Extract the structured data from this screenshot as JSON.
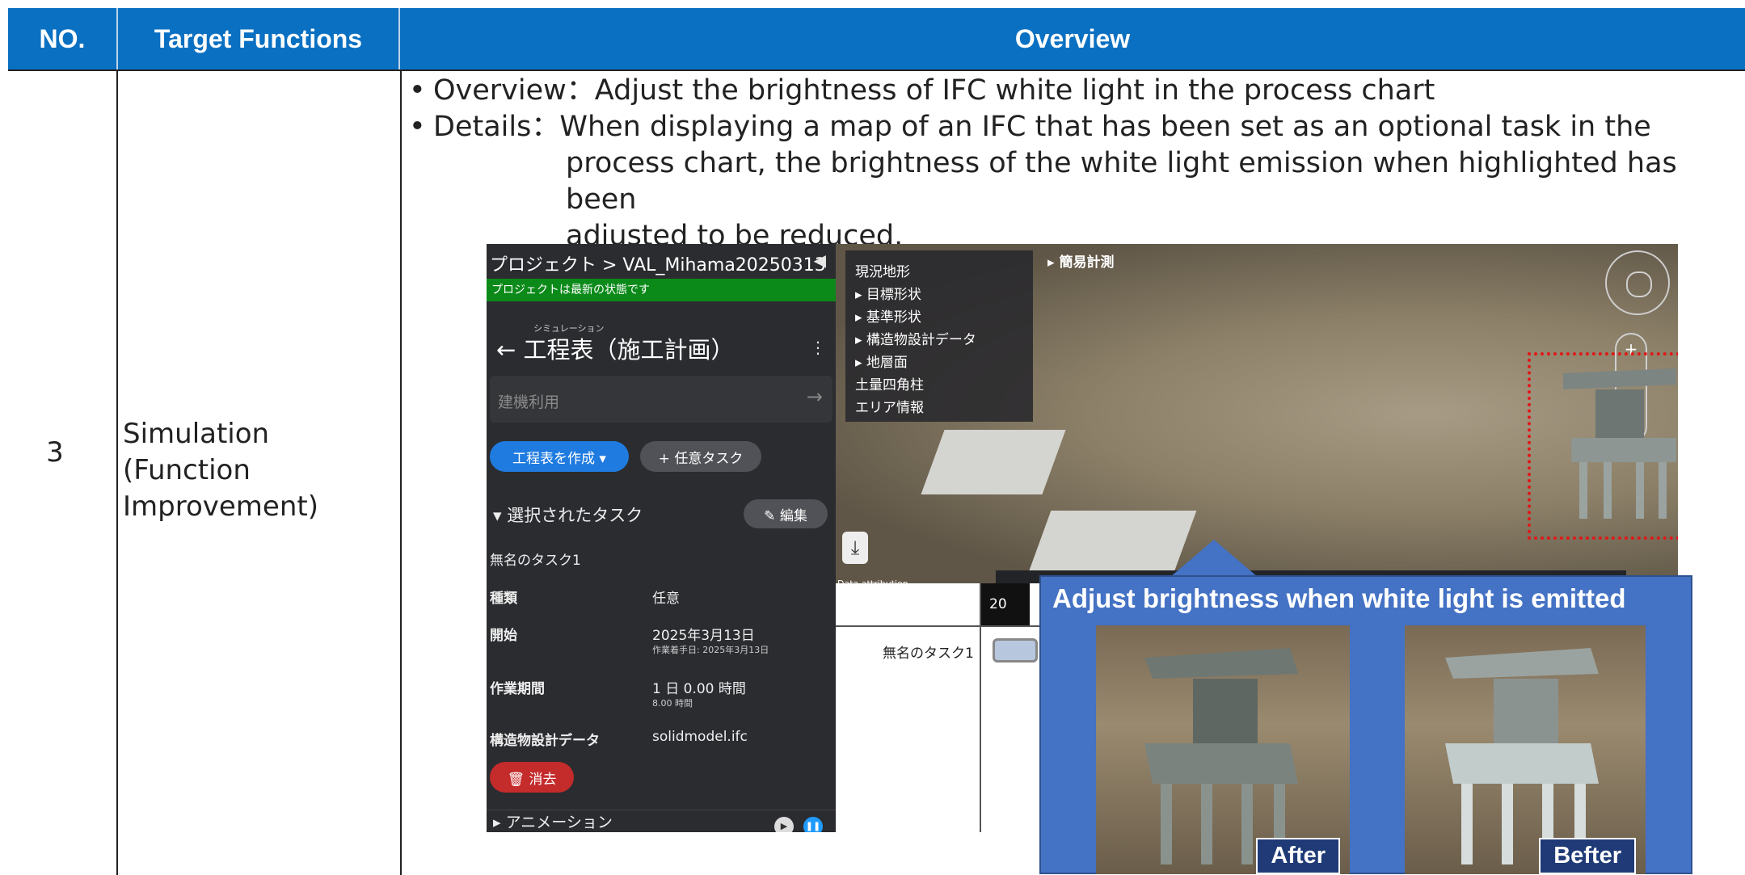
{
  "table": {
    "headers": [
      "NO.",
      "Target Functions",
      "Overview"
    ],
    "row": {
      "no": "3",
      "function": "Simulation\n(Function\nImprovement)",
      "overview_line": "Overview：Adjust the brightness of IFC white light in the process chart",
      "details_line1": "Details：When displaying a map of an IFC that has been set as an optional task in the",
      "details_line2": "process chart, the brightness of the white light emission when highlighted has been",
      "details_line3": "adjusted to be reduced."
    }
  },
  "app": {
    "breadcrumb": "プロジェクト > VAL_Mihama20250313",
    "status": "プロジェクトは最新の状態です",
    "subtitle": "シミュレーション",
    "title": "← 工程表（施工計画）",
    "search_placeholder": "建機利用",
    "create_button": "工程表を作成 ▾",
    "optional_task_button": "+ 任意タスク",
    "selected_task_header": "▾ 選択されたタスク",
    "edit_button": "✎ 編集",
    "task_name": "無名のタスク1",
    "fields": [
      {
        "key": "種類",
        "value": "任意",
        "sub": ""
      },
      {
        "key": "開始",
        "value": "2025年3月13日",
        "sub": "作業着手日: 2025年3月13日"
      },
      {
        "key": "作業期間",
        "value": "1 日 0.00 時間",
        "sub": "8.00 時間"
      },
      {
        "key": "構造物設計データ",
        "value": "solidmodel.ifc",
        "sub": ""
      }
    ],
    "delete_button": "🗑 消去",
    "animation_label": "▸ アニメーション",
    "layers": [
      "現況地形",
      "▸ 目標形状",
      "▸ 基準形状",
      "▸ 構造物設計データ",
      "▸ 地層面",
      "土量四角柱",
      "エリア情報"
    ],
    "simple_measure": "▸ 簡易計測",
    "data_attribution": "Data attribution",
    "gantt_task": "無名のタスク1",
    "gantt_header": "20"
  },
  "callout": {
    "title": "Adjust brightness when white light is emitted",
    "after_label": "After",
    "before_label": "Befter"
  },
  "colors": {
    "header_blue": "#0a70c2",
    "callout_blue": "#4472c4",
    "status_green": "#0b8a19"
  }
}
